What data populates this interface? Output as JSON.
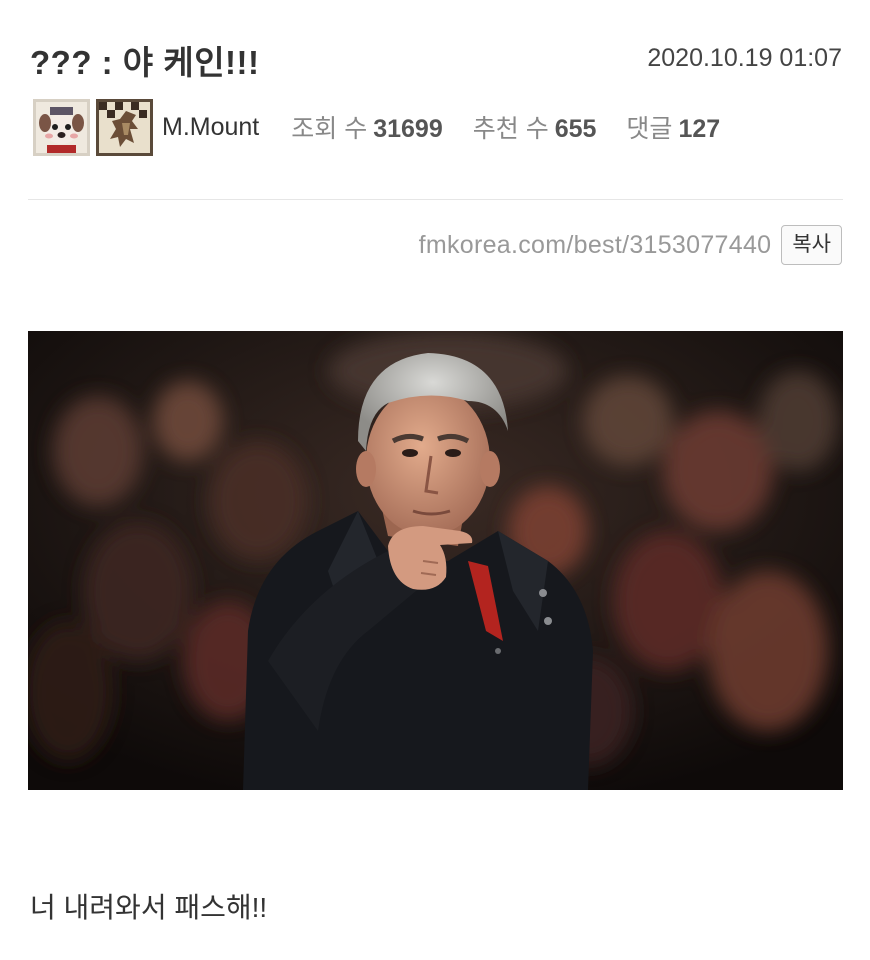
{
  "post": {
    "title": "??? : 야 케인!!!",
    "date": "2020.10.19 01:07",
    "author": "M.Mount",
    "views_label": "조회 수",
    "views": "31699",
    "recommend_label": "추천 수",
    "recommend": "655",
    "comments_label": "댓글",
    "comments": "127",
    "url": "fmkorea.com/best/3153077440",
    "copy_label": "복사",
    "body": "너 내려와서 패스해!!"
  },
  "icons": {
    "level_badge": "dog-avatar-icon",
    "team_badge": "crest-icon"
  },
  "colors": {
    "title": "#333333",
    "muted": "#999999",
    "stat_label": "#888888",
    "divider": "#e6e6e6"
  }
}
